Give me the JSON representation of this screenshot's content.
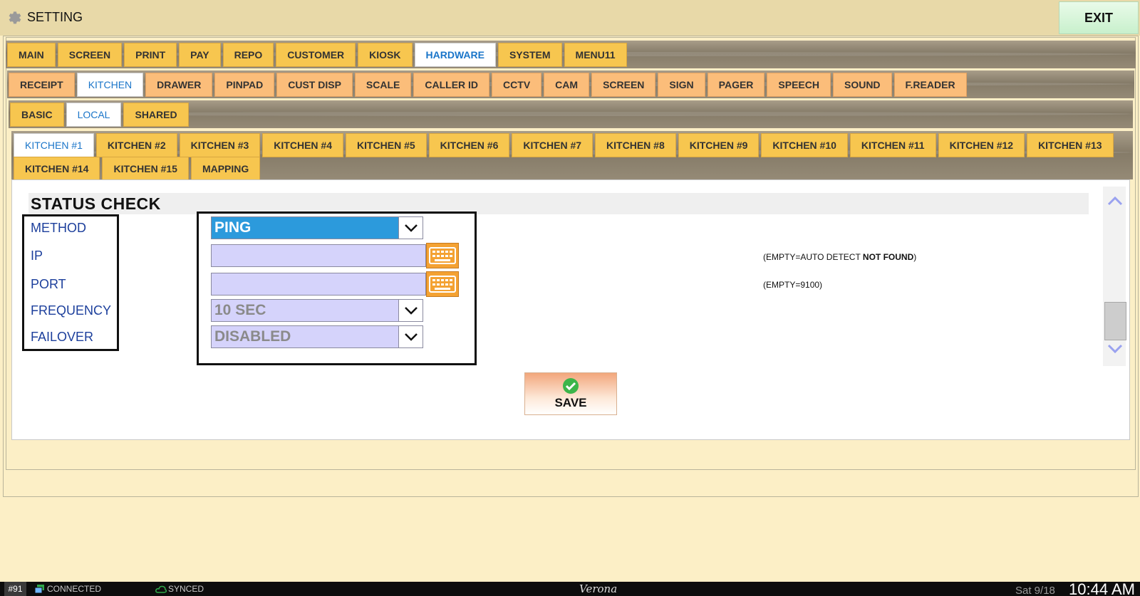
{
  "app": {
    "title": "SETTING",
    "exit_label": "EXIT"
  },
  "tabs_level1": [
    {
      "label": "MAIN"
    },
    {
      "label": "SCREEN"
    },
    {
      "label": "PRINT"
    },
    {
      "label": "PAY"
    },
    {
      "label": "REPO"
    },
    {
      "label": "CUSTOMER"
    },
    {
      "label": "KIOSK"
    },
    {
      "label": "HARDWARE",
      "active": true
    },
    {
      "label": "SYSTEM"
    },
    {
      "label": "MENU11"
    }
  ],
  "tabs_level2": [
    {
      "label": "RECEIPT"
    },
    {
      "label": "KITCHEN",
      "active": true
    },
    {
      "label": "DRAWER"
    },
    {
      "label": "PINPAD"
    },
    {
      "label": "CUST DISP"
    },
    {
      "label": "SCALE"
    },
    {
      "label": "CALLER ID"
    },
    {
      "label": "CCTV"
    },
    {
      "label": "CAM"
    },
    {
      "label": "SCREEN"
    },
    {
      "label": "SIGN"
    },
    {
      "label": "PAGER"
    },
    {
      "label": "SPEECH"
    },
    {
      "label": "SOUND"
    },
    {
      "label": "F.READER"
    }
  ],
  "tabs_level3": [
    {
      "label": "BASIC"
    },
    {
      "label": "LOCAL",
      "active": true
    },
    {
      "label": "SHARED"
    }
  ],
  "tabs_level4_row1": [
    {
      "label": "KITCHEN #1",
      "active": true
    },
    {
      "label": "KITCHEN #2"
    },
    {
      "label": "KITCHEN #3"
    },
    {
      "label": "KITCHEN #4"
    },
    {
      "label": "KITCHEN #5"
    },
    {
      "label": "KITCHEN #6"
    },
    {
      "label": "KITCHEN #7"
    },
    {
      "label": "KITCHEN #8"
    },
    {
      "label": "KITCHEN #9"
    },
    {
      "label": "KITCHEN #10"
    },
    {
      "label": "KITCHEN #11"
    },
    {
      "label": "KITCHEN #12"
    },
    {
      "label": "KITCHEN #13"
    }
  ],
  "tabs_level4_row2": [
    {
      "label": "KITCHEN #14"
    },
    {
      "label": "KITCHEN #15"
    },
    {
      "label": "MAPPING"
    }
  ],
  "section": {
    "title": "STATUS CHECK"
  },
  "fields": {
    "method": {
      "label": "METHOD",
      "value": "PING"
    },
    "ip": {
      "label": "IP",
      "value": "",
      "hint_prefix": "(EMPTY=AUTO DETECT ",
      "hint_bold": "NOT FOUND",
      "hint_suffix": ")"
    },
    "port": {
      "label": "PORT",
      "value": "",
      "hint": "(EMPTY=9100)"
    },
    "frequency": {
      "label": "FREQUENCY",
      "value": "10 SEC"
    },
    "failover": {
      "label": "FAILOVER",
      "value": "DISABLED"
    }
  },
  "save_label": "SAVE",
  "colors": {
    "tab_yellow": "#f7c64f",
    "tab_orange": "#fbbd7a",
    "active_text": "#1a75c9",
    "keyboard_orange": "#f4a233",
    "field_fill": "#d5d3fb",
    "select_blue": "#2c9adc"
  },
  "statusbar": {
    "station": "#91",
    "connection": "CONNECTED",
    "sync": "SYNCED",
    "brand": "Verona",
    "date": "Sat 9/18",
    "time": "10:44 AM"
  }
}
